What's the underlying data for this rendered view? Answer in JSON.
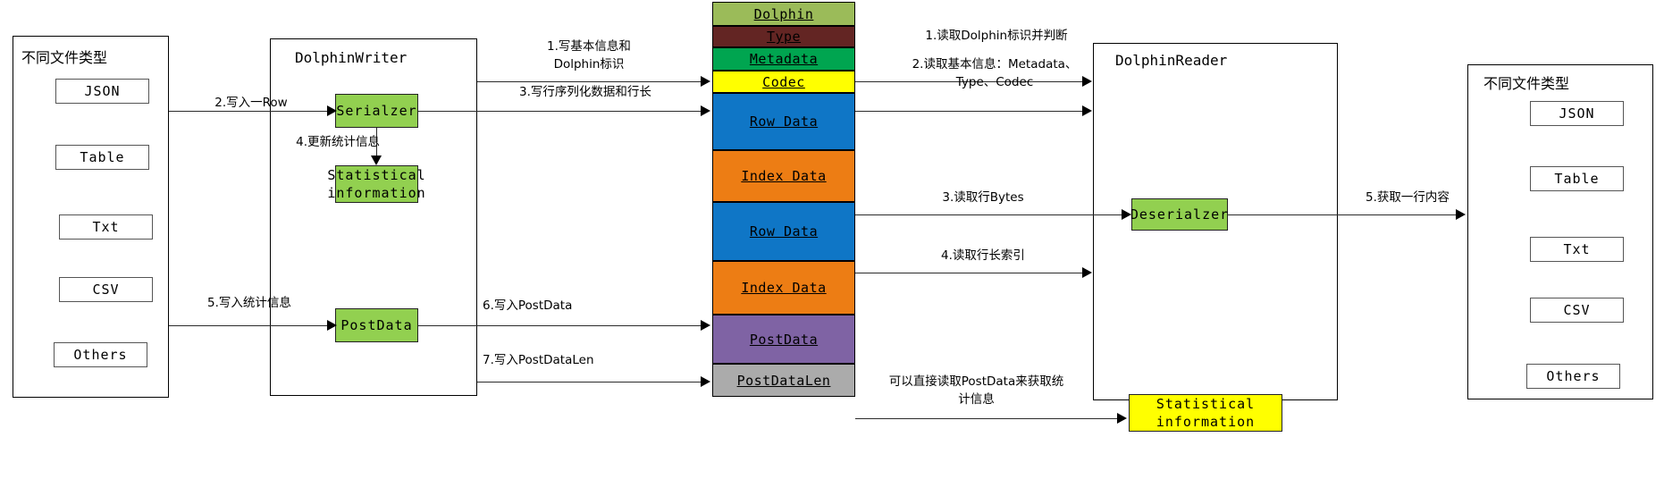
{
  "panels": {
    "source_files": {
      "title": "不同文件类型"
    },
    "writer": {
      "title": "DolphinWriter"
    },
    "reader": {
      "title": "DolphinReader"
    },
    "target_files": {
      "title": "不同文件类型"
    }
  },
  "source_file_types": [
    {
      "label": "JSON"
    },
    {
      "label": "Table"
    },
    {
      "label": "Txt"
    },
    {
      "label": "CSV"
    },
    {
      "label": "Others"
    }
  ],
  "target_file_types": [
    {
      "label": "JSON"
    },
    {
      "label": "Table"
    },
    {
      "label": "Txt"
    },
    {
      "label": "CSV"
    },
    {
      "label": "Others"
    }
  ],
  "writer_nodes": {
    "serializer": "Serialzer",
    "statistical_information": "Statistical\ninformation",
    "postdata": "PostData"
  },
  "reader_nodes": {
    "deserializer": "Deserialzer",
    "statistical_information": "Statistical\ninformation"
  },
  "file_format": {
    "blocks": [
      {
        "label": "Dolphin",
        "color": "#9BBB59"
      },
      {
        "label": "Type",
        "color": "#632523"
      },
      {
        "label": "Metadata",
        "color": "#00A550"
      },
      {
        "label": "Codec",
        "color": "#FFFF00"
      },
      {
        "label": "Row Data",
        "color": "#0F76C6"
      },
      {
        "label": "Index Data",
        "color": "#ED7D14"
      },
      {
        "label": "Row Data",
        "color": "#0F76C6"
      },
      {
        "label": "Index Data",
        "color": "#ED7D14"
      },
      {
        "label": "PostData",
        "color": "#7F63A4"
      },
      {
        "label": "PostDataLen",
        "color": "#ABABAB"
      }
    ]
  },
  "write_edges": {
    "e_write_row": "2.写入一Row",
    "e_write_stats": "5.写入统计信息",
    "e_update_stats": "4.更新统计信息",
    "e_basic_info": "1.写基本信息和\nDolphin标识",
    "e_row_bytes": "3.写行序列化数据和行长",
    "e_postdata": "6.写入PostData",
    "e_postdatalen": "7.写入PostDataLen"
  },
  "read_edges": {
    "e_read_magic": "1.读取Dolphin标识并判断",
    "e_read_basic": "2.读取基本信息：Metadata、\nType、Codec",
    "e_read_row_bytes": "3.读取行Bytes",
    "e_read_index": "4.读取行长索引",
    "e_read_postdata": "可以直接读取PostData来获取统\n计信息",
    "e_get_row": "5.获取一行内容"
  },
  "colors": {
    "green_node": "#92D050",
    "yellow_node": "#FFFF00",
    "line": "#2b2b2b"
  }
}
